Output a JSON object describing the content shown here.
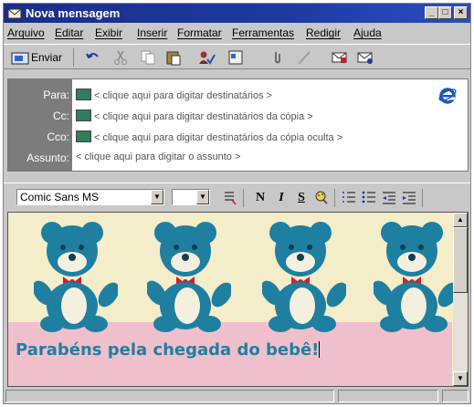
{
  "window": {
    "title": "Nova mensagem"
  },
  "menu": {
    "items": [
      "Arquivo",
      "Editar",
      "Exibir",
      "Inserir",
      "Formatar",
      "Ferramentas",
      "Redigir",
      "Ajuda"
    ]
  },
  "toolbar": {
    "send_label": "Enviar"
  },
  "header": {
    "to_label": "Para:",
    "to_value": "< clique aqui para digitar destinatários >",
    "cc_label": "Cc:",
    "cc_value": "< clique aqui para digitar destinatários da cópia >",
    "bcc_label": "Cco:",
    "bcc_value": "< clique aqui para digitar destinatários da cópia oculta >",
    "subject_label": "Assunto:",
    "subject_value": "< clique aqui para digitar o assunto >"
  },
  "format": {
    "font_name": "Comic Sans MS",
    "font_size": "",
    "bold": "N",
    "italic": "I",
    "underline": "S"
  },
  "body": {
    "message": "Parabéns pela chegada do bebê!",
    "stationery_colors": {
      "bear": "#1e7fa0",
      "bow": "#d0202a",
      "background": "#f3edc9",
      "band": "#f0bfcc"
    }
  },
  "colors": {
    "titlebar": "#1a2d8a",
    "chrome": "#c8c8c8"
  }
}
